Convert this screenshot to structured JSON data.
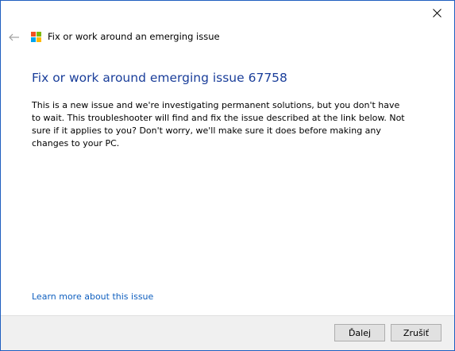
{
  "window": {
    "title": "Fix or work around an emerging issue"
  },
  "icons": {
    "close": "close-icon",
    "back": "back-arrow-icon",
    "logo": "windows-logo-icon"
  },
  "main": {
    "heading": "Fix or work around emerging issue 67758",
    "description": "This is a new issue and we're investigating permanent solutions, but you don't have to wait.  This troubleshooter will find and fix the issue described at the link below.  Not sure if it applies to you? Don't worry, we'll make sure it does before making any changes to your PC.",
    "learn_more_link": "Learn more about this issue"
  },
  "footer": {
    "next_label": "Ďalej",
    "cancel_label": "Zrušiť"
  },
  "colors": {
    "accent": "#1a3e9a",
    "link": "#0f5fbf",
    "border": "#1f5fbf",
    "footer_bg": "#f0f0f0",
    "logo_red": "#f25022",
    "logo_green": "#7fba00",
    "logo_blue": "#00a4ef",
    "logo_yellow": "#ffb900"
  }
}
